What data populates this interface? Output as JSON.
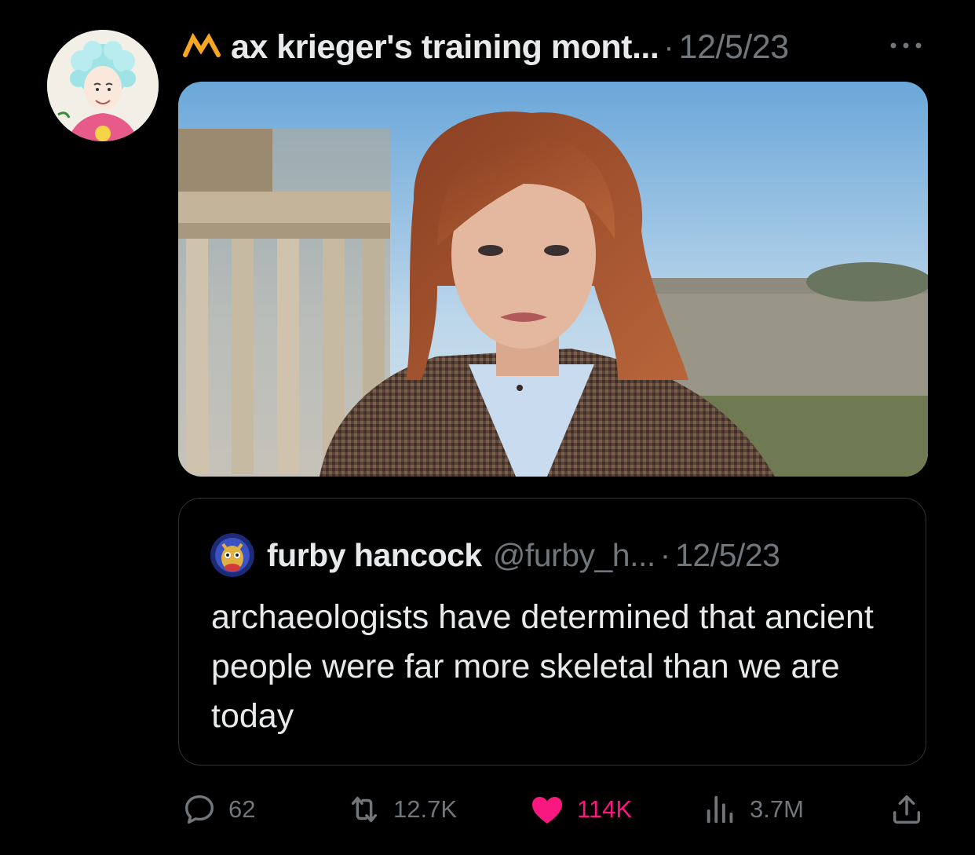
{
  "tweet": {
    "display_name": "ax krieger's training mont...",
    "separator": "·",
    "timestamp": "12/5/23",
    "badge_icon": "crown-m-icon",
    "more_icon": "more-options-icon",
    "avatar_icon": "illustrated-avatar"
  },
  "photo": {
    "icon": "photo-woman-ruins"
  },
  "quote": {
    "display_name": "furby hancock",
    "handle": "@furby_h...",
    "separator": "·",
    "timestamp": "12/5/23",
    "text": "archaeologists have determined that ancient people were far more skeletal than we are today",
    "avatar_icon": "furby-avatar"
  },
  "actions": {
    "reply": {
      "count": "62",
      "icon": "reply-icon"
    },
    "retweet": {
      "count": "12.7K",
      "icon": "retweet-icon"
    },
    "like": {
      "count": "114K",
      "icon": "heart-filled-icon",
      "color": "#f91880"
    },
    "views": {
      "count": "3.7M",
      "icon": "views-chart-icon"
    },
    "share": {
      "icon": "share-icon"
    }
  },
  "colors": {
    "background": "#000000",
    "primary_text": "#e7e9ea",
    "secondary_text": "#71767b",
    "border": "#2f3336",
    "like": "#f91880",
    "badge": "#f5a623"
  }
}
